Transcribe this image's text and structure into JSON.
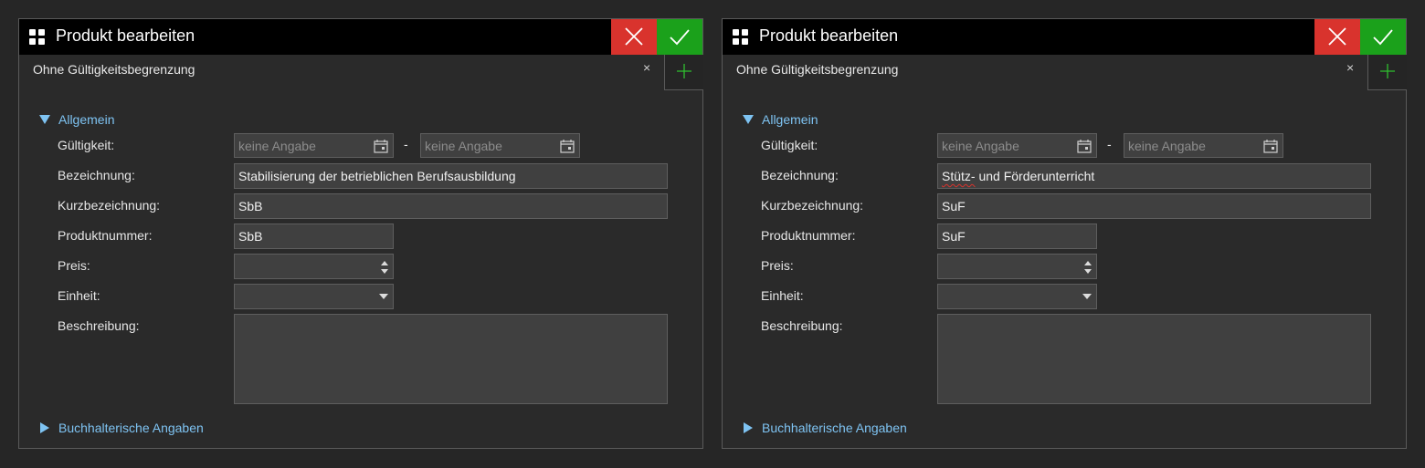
{
  "dialogs": [
    {
      "title": "Produkt bearbeiten",
      "tab_label": "Ohne Gültigkeitsbegrenzung",
      "tab_close": "×",
      "section_general": "Allgemein",
      "section_accounting": "Buchhalterische Angaben",
      "labels": {
        "validity": "Gültigkeit:",
        "name": "Bezeichnung:",
        "short_name": "Kurzbezeichnung:",
        "product_number": "Produktnummer:",
        "price": "Preis:",
        "unit": "Einheit:",
        "description": "Beschreibung:"
      },
      "valid_from_placeholder": "keine Angabe",
      "valid_to_placeholder": "keine Angabe",
      "date_separator": "-",
      "name_value": "Stabilisierung der betrieblichen Berufsausbildung",
      "short_name_value": "SbB",
      "product_number_value": "SbB",
      "price_value": "",
      "unit_value": "",
      "description_value": ""
    },
    {
      "title": "Produkt bearbeiten",
      "tab_label": "Ohne Gültigkeitsbegrenzung",
      "tab_close": "×",
      "section_general": "Allgemein",
      "section_accounting": "Buchhalterische Angaben",
      "labels": {
        "validity": "Gültigkeit:",
        "name": "Bezeichnung:",
        "short_name": "Kurzbezeichnung:",
        "product_number": "Produktnummer:",
        "price": "Preis:",
        "unit": "Einheit:",
        "description": "Beschreibung:"
      },
      "valid_from_placeholder": "keine Angabe",
      "valid_to_placeholder": "keine Angabe",
      "date_separator": "-",
      "name_value": "Stütz- und Förderunterricht",
      "name_spellcheck_word": "Stütz-",
      "name_rest": " und Förderunterricht",
      "short_name_value": "SuF",
      "product_number_value": "SuF",
      "price_value": "",
      "unit_value": "",
      "description_value": ""
    }
  ],
  "icons": {
    "app": "grid-icon",
    "cancel": "close-icon",
    "confirm": "check-icon",
    "add_tab": "plus-icon",
    "calendar": "calendar-icon",
    "expanded": "triangle-down-icon",
    "collapsed": "triangle-right-icon"
  },
  "colors": {
    "cancel": "#d9332d",
    "confirm": "#1ba11b",
    "section_link": "#7ec3f2",
    "background": "#262626"
  }
}
